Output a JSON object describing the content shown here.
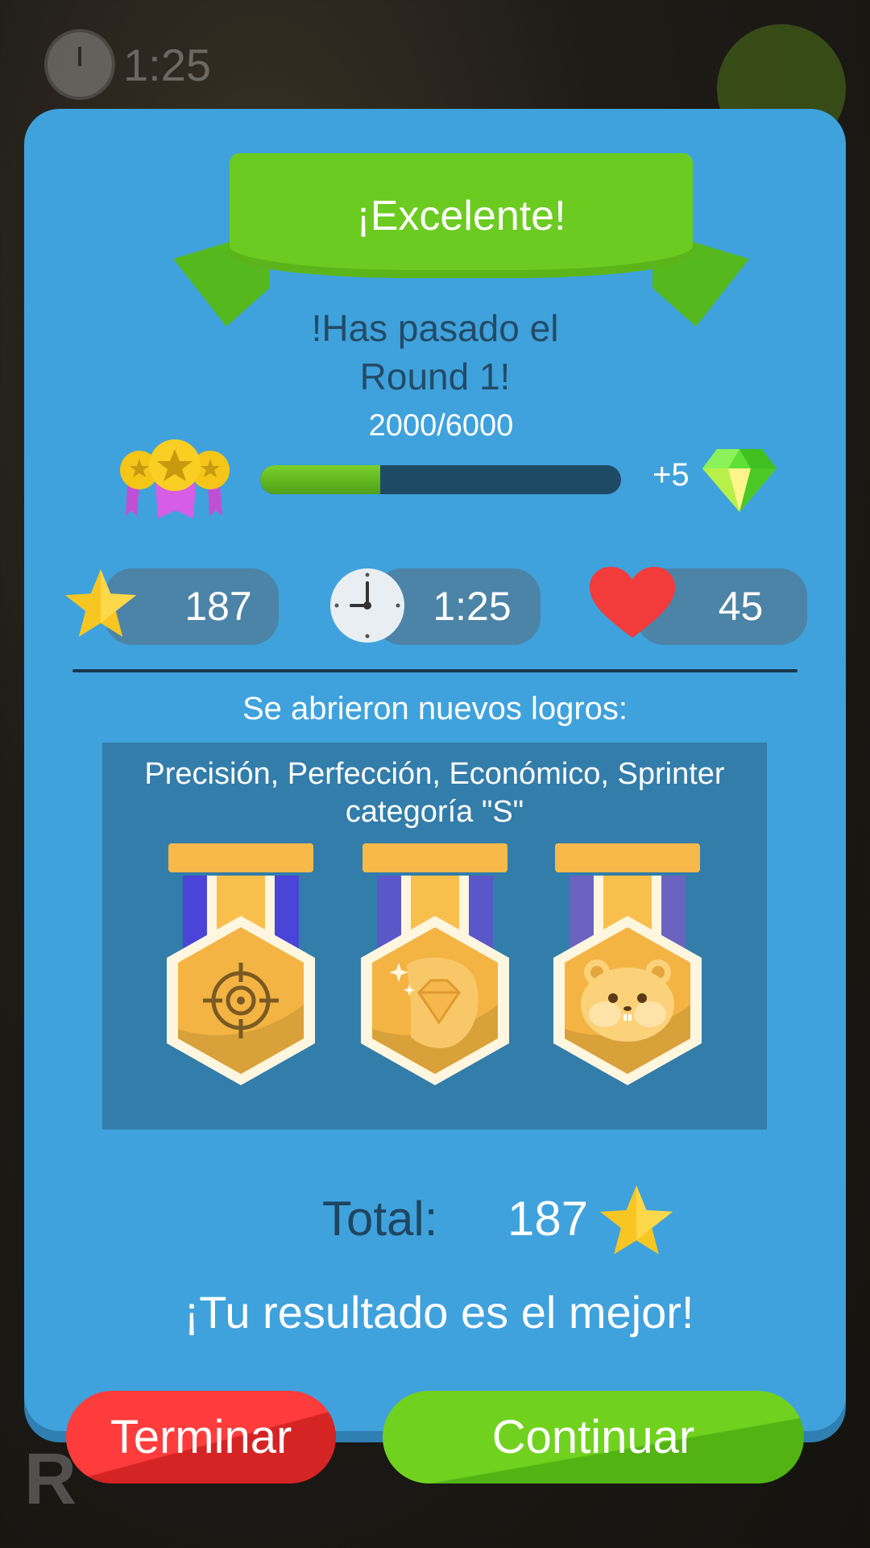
{
  "background": {
    "hud_time": "1:25",
    "round_letter": "R"
  },
  "ribbon": {
    "title": "¡Excelente!"
  },
  "subtitle": {
    "line1": "!Has pasado el",
    "line2": "Round 1!"
  },
  "progress": {
    "text": "2000/6000",
    "value": 2000,
    "max": 6000,
    "reward": "+5"
  },
  "stats": {
    "stars": "187",
    "time": "1:25",
    "lives": "45"
  },
  "achievements": {
    "heading": "Se abrieron nuevos logros:",
    "list_line1": "Precisión, Perfección, Económico, Sprinter",
    "list_line2": "categoría  \"S\"",
    "badges": [
      "target-icon",
      "diamond-hand-icon",
      "hamster-icon"
    ]
  },
  "total": {
    "label": "Total:",
    "value": "187"
  },
  "result_message": "¡Tu resultado es el mejor!",
  "buttons": {
    "end": "Terminar",
    "continue": "Continuar"
  },
  "colors": {
    "panel": "#3fa2dc",
    "ribbon": "#6bcb20",
    "end_button": "#ff3c3c",
    "continue_button": "#70d21e",
    "stat_pill": "#4c84a8"
  }
}
